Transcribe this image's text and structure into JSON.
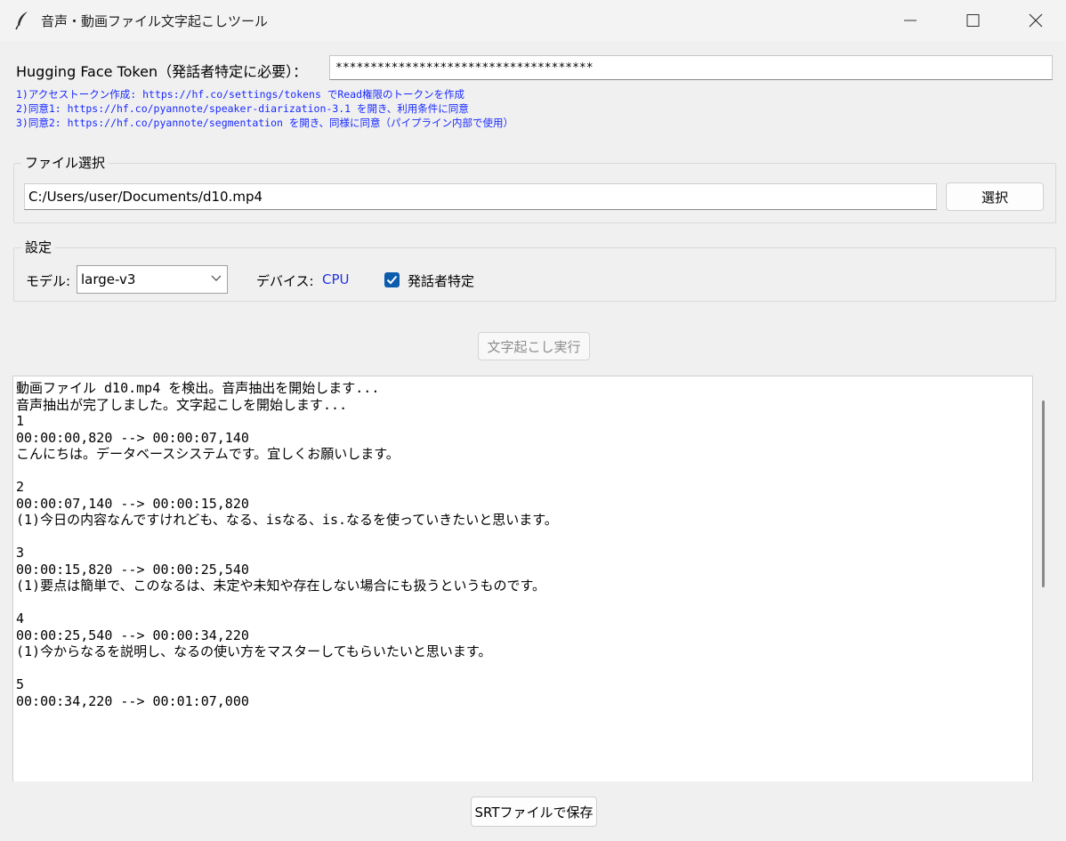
{
  "window": {
    "title": "音声・動画ファイル文字起こしツール",
    "icon": "feather-icon",
    "controls": [
      "minimize-icon",
      "maximize-icon",
      "close-icon"
    ]
  },
  "token": {
    "label": "Hugging Face Token（発話者特定に必要）：",
    "value": "*************************************"
  },
  "help": {
    "line1": "1)アクセストークン作成: https://hf.co/settings/tokens でRead権限のトークンを作成",
    "line2": "2)同意1: https://hf.co/pyannote/speaker-diarization-3.1 を開き、利用条件に同意",
    "line3": "3)同意2: https://hf.co/pyannote/segmentation を開き、同様に同意（パイプライン内部で使用）",
    "color": "#1a2bff"
  },
  "file": {
    "group_title": "ファイル選択",
    "path": "C:/Users/user/Documents/d10.mp4",
    "select_label": "選択"
  },
  "settings": {
    "group_title": "設定",
    "model_label": "モデル:",
    "model_value": "large-v3",
    "device_label": "デバイス:",
    "device_value": "CPU",
    "speaker_label": "発話者特定",
    "speaker_checked": true
  },
  "run_label": "文字起こし実行",
  "log": {
    "text": "動画ファイル d10.mp4 を検出。音声抽出を開始します...\n音声抽出が完了しました。文字起こしを開始します...\n1\n00:00:00,820 --> 00:00:07,140\nこんにちは。データベースシステムです。宜しくお願いします。\n\n2\n00:00:07,140 --> 00:00:15,820\n(1)今日の内容なんですけれども、なる、isなる、is.なるを使っていきたいと思います。\n\n3\n00:00:15,820 --> 00:00:25,540\n(1)要点は簡単で、このなるは、未定や未知や存在しない場合にも扱うというものです。\n\n4\n00:00:25,540 --> 00:00:34,220\n(1)今からなるを説明し、なるの使い方をマスターしてもらいたいと思います。\n\n5\n00:00:34,220 --> 00:01:07,000"
  },
  "save_label": "SRTファイルで保存",
  "colors": {
    "background": "#f0f0f0",
    "accent": "#0b5cad",
    "device_value": "#2233dd"
  }
}
